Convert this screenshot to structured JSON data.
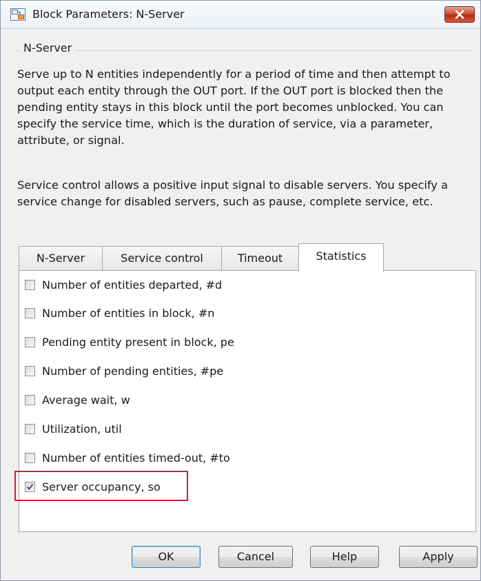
{
  "window": {
    "title": "Block Parameters: N-Server",
    "icon": "simulink-block-icon",
    "close_icon": "close-icon"
  },
  "description": {
    "group_label": "N-Server",
    "paragraph_1": "Serve up to N entities independently for a period of time and then attempt to output each entity through the OUT port. If the OUT port is blocked then the pending entity stays in this block until the port becomes unblocked. You can specify the service time, which is the duration of service, via a parameter, attribute, or signal.",
    "paragraph_2": "Service control allows a positive input signal to disable servers. You specify a service change for disabled servers, such as pause, complete service, etc."
  },
  "tabs": [
    {
      "label": "N-Server",
      "active": false
    },
    {
      "label": "Service control",
      "active": false
    },
    {
      "label": "Timeout",
      "active": false
    },
    {
      "label": "Statistics",
      "active": true
    }
  ],
  "statistics": [
    {
      "label": "Number of entities departed, #d",
      "checked": false
    },
    {
      "label": "Number of entities in block, #n",
      "checked": false
    },
    {
      "label": "Pending entity present in block, pe",
      "checked": false
    },
    {
      "label": "Number of pending entities, #pe",
      "checked": false
    },
    {
      "label": "Average wait, w",
      "checked": false
    },
    {
      "label": "Utilization, util",
      "checked": false
    },
    {
      "label": "Number of entities timed-out, #to",
      "checked": false
    },
    {
      "label": "Server occupancy, so",
      "checked": true
    }
  ],
  "highlight_color": "#c0262d",
  "buttons": {
    "ok": "OK",
    "cancel": "Cancel",
    "help": "Help",
    "apply": "Apply"
  }
}
